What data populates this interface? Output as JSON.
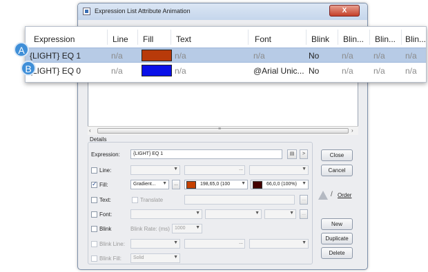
{
  "window": {
    "title": "Expression List Attribute Animation",
    "close_glyph": "X"
  },
  "table": {
    "headers": [
      "Expression",
      "Line",
      "Fill",
      "Text",
      "Font",
      "Blink",
      "Blin...",
      "Blin...",
      "Blin..."
    ],
    "rows": [
      {
        "callout": "A",
        "expression": "{LIGHT} EQ 1",
        "line": "n/a",
        "fill_color": "#b83a0a",
        "text": "n/a",
        "font": "n/a",
        "blink": "No",
        "blink2": "n/a",
        "blink3": "n/a",
        "blink4": "n/a"
      },
      {
        "callout": "B",
        "expression": "{LIGHT} EQ 0",
        "line": "n/a",
        "fill_color": "#0a10e8",
        "text": "n/a",
        "font": "@Arial Unic...",
        "blink": "No",
        "blink2": "n/a",
        "blink3": "n/a",
        "blink4": "n/a"
      }
    ]
  },
  "details": {
    "group_label": "Details",
    "expression_label": "Expression:",
    "expression_value": "{LIGHT} EQ 1",
    "line_label": "Line:",
    "fill_label": "Fill:",
    "fill_type": "Gradient...",
    "fill_color1_label": "198,65,0 (100",
    "fill_color1": "#c64100",
    "fill_color2_label": "66,0,0 (100%)",
    "fill_color2": "#420000",
    "text_label": "Text:",
    "translate_label": "Translate",
    "font_label": "Font:",
    "blink_label": "Blink",
    "blink_rate_label": "Blink Rate: (ms)",
    "blink_rate_value": "1000",
    "blink_line_label": "Blink Line:",
    "blink_fill_label": "Blink Fill:",
    "blink_fill_value": "Solid",
    "ellipsis": "...",
    "arrow_right": ">",
    "arrow_down": "▼"
  },
  "buttons": {
    "close": "Close",
    "cancel": "Cancel",
    "order": "Order",
    "order_slash": "/",
    "new": "New",
    "duplicate": "Duplicate",
    "delete": "Delete"
  },
  "scrollbar": {
    "left": "‹",
    "right": "›",
    "grip": "≡"
  }
}
